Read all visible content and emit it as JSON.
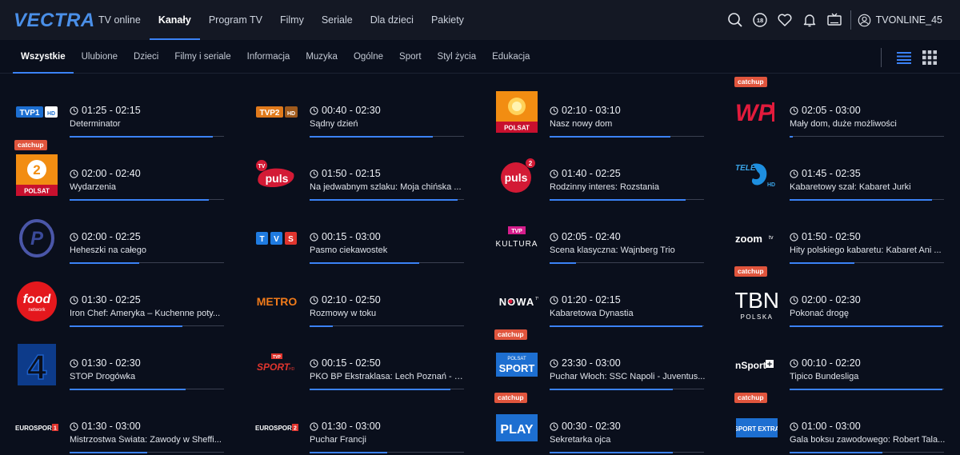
{
  "brand": "VECTRA",
  "nav": [
    "TV online",
    "Kanały",
    "Program TV",
    "Filmy",
    "Seriale",
    "Dla dzieci",
    "Pakiety"
  ],
  "nav_active": 1,
  "header": {
    "age_badge": "18",
    "username": "TVONLINE_45"
  },
  "categories": [
    "Wszystkie",
    "Ulubione",
    "Dzieci",
    "Filmy i seriale",
    "Informacja",
    "Muzyka",
    "Ogólne",
    "Sport",
    "Styl życia",
    "Edukacja"
  ],
  "category_active": 0,
  "catchup_label": "catchup",
  "colors": {
    "accent": "#3b82f6",
    "catchup": "#e0553d",
    "background": "#0a0f1c"
  },
  "channels": [
    {
      "logo": "TVP1",
      "time": "01:25 - 02:15",
      "title": "Determinator",
      "progress": 0.93,
      "catchup": false
    },
    {
      "logo": "TVP2",
      "time": "00:40 - 02:30",
      "title": "Sądny dzień",
      "progress": 0.8,
      "catchup": false
    },
    {
      "logo": "POLSAT",
      "time": "02:10 - 03:10",
      "title": "Nasz nowy dom",
      "progress": 0.78,
      "catchup": false
    },
    {
      "logo": "WP",
      "time": "02:05 - 03:00",
      "title": "Mały dom, duże możliwości",
      "progress": 0.02,
      "catchup": true
    },
    {
      "logo": "POLSAT 2",
      "time": "02:00 - 02:40",
      "title": "Wydarzenia",
      "progress": 0.9,
      "catchup": true
    },
    {
      "logo": "TV puls",
      "time": "01:50 - 02:15",
      "title": "Na jedwabnym szlaku: Moja chińska ...",
      "progress": 0.96,
      "catchup": false
    },
    {
      "logo": "puls 2",
      "time": "01:40 - 02:25",
      "title": "Rodzinny interes: Rozstania",
      "progress": 0.88,
      "catchup": false
    },
    {
      "logo": "TELE 5",
      "time": "01:45 - 02:35",
      "title": "Kabaretowy szał: Kabaret Jurki",
      "progress": 0.92,
      "catchup": false
    },
    {
      "logo": "Polsat 1",
      "time": "02:00 - 02:25",
      "title": "Heheszki na całego",
      "progress": 0.45,
      "catchup": false
    },
    {
      "logo": "TVS",
      "time": "00:15 - 03:00",
      "title": "Pasmo ciekawostek",
      "progress": 0.71,
      "catchup": false
    },
    {
      "logo": "TVP KULTURA",
      "time": "02:05 - 02:40",
      "title": "Scena klasyczna: Wajnberg Trio",
      "progress": 0.17,
      "catchup": false
    },
    {
      "logo": "zoom tv",
      "time": "01:50 - 02:50",
      "title": "Hity polskiego kabaretu: Kabaret Ani ...",
      "progress": 0.42,
      "catchup": false
    },
    {
      "logo": "food network",
      "time": "01:30 - 02:25",
      "title": "Iron Chef: Ameryka – Kuchenne poty...",
      "progress": 0.73,
      "catchup": false
    },
    {
      "logo": "METRO",
      "time": "02:10 - 02:50",
      "title": "Rozmowy w toku",
      "progress": 0.15,
      "catchup": false
    },
    {
      "logo": "NOWA TV",
      "time": "01:20 - 02:15",
      "title": "Kabaretowa Dynastia",
      "progress": 0.99,
      "catchup": false
    },
    {
      "logo": "TBN POLSKA",
      "time": "02:00 - 02:30",
      "title": "Pokonać drogę",
      "progress": 0.99,
      "catchup": true
    },
    {
      "logo": "TV4",
      "time": "01:30 - 02:30",
      "title": "STOP Drogówka",
      "progress": 0.75,
      "catchup": false
    },
    {
      "logo": "TVP SPORT HD",
      "time": "00:15 - 02:50",
      "title": "PKO BP Ekstraklasa: Lech Poznań - P...",
      "progress": 0.91,
      "catchup": false
    },
    {
      "logo": "POLSAT SPORT",
      "time": "23:30 - 03:00",
      "title": "Puchar Włoch: SSC Napoli - Juventus...",
      "progress": 0.8,
      "catchup": true
    },
    {
      "logo": "nSport+",
      "time": "00:10 - 02:20",
      "title": "Tipico Bundesliga",
      "progress": 0.99,
      "catchup": false
    },
    {
      "logo": "EUROSPORT 1",
      "time": "01:30 - 03:00",
      "title": "Mistrzostwa Świata: Zawody w Sheffi...",
      "progress": 0.5,
      "catchup": false
    },
    {
      "logo": "EUROSPORT 2",
      "time": "01:30 - 03:00",
      "title": "Puchar Francji",
      "progress": 0.5,
      "catchup": false
    },
    {
      "logo": "PLAY",
      "time": "00:30 - 02:30",
      "title": "Sekretarka ojca",
      "progress": 0.8,
      "catchup": true
    },
    {
      "logo": "POLSAT SPORT EXTRA",
      "time": "01:00 - 03:00",
      "title": "Gala boksu zawodowego: Robert Tala...",
      "progress": 0.6,
      "catchup": true
    }
  ]
}
